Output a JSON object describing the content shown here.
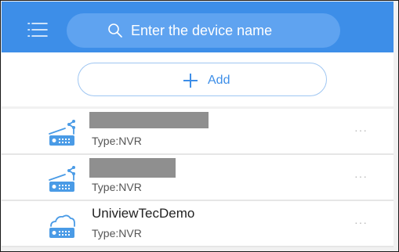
{
  "header": {
    "menu_icon": "menu-icon",
    "search": {
      "icon": "search-icon",
      "placeholder": "Enter the device name"
    }
  },
  "add_button": {
    "icon": "plus-icon",
    "label": "Add"
  },
  "devices": [
    {
      "name": "",
      "name_redacted": true,
      "type": "Type:NVR",
      "icon": "nvr-share-icon",
      "more": "···"
    },
    {
      "name": "",
      "name_redacted": true,
      "type": "Type:NVR",
      "icon": "nvr-share-icon",
      "more": "···"
    },
    {
      "name": "UniviewTecDemo",
      "name_redacted": false,
      "type": "Type:NVR",
      "icon": "nvr-cloud-icon",
      "more": "···"
    }
  ],
  "colors": {
    "accent": "#3d8ee8",
    "search_bg": "#5fa3f0",
    "icon": "#4a9be6"
  }
}
